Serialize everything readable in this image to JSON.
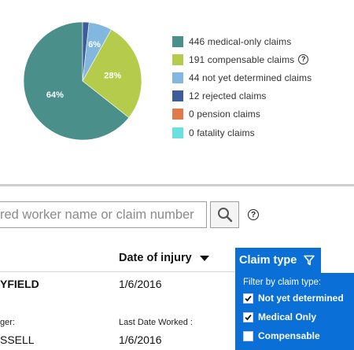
{
  "chart_data": {
    "type": "pie",
    "slices": [
      {
        "label": "446 medical-only claims",
        "value": 446,
        "color": "#4a8f8a",
        "pct_label": "64%"
      },
      {
        "label": "191 compensable claims",
        "value": 191,
        "color": "#b5cb4b",
        "pct_label": "28%"
      },
      {
        "label": "44 not yet determined claims",
        "value": 44,
        "color": "#82b8df",
        "pct_label": "6%"
      },
      {
        "label": "12 rejected claims",
        "value": 12,
        "color": "#3d5c9a",
        "pct_label": ""
      },
      {
        "label": "0 pension claims",
        "value": 0,
        "color": "#e07a4d",
        "pct_label": ""
      },
      {
        "label": "0 fatality claims",
        "value": 0,
        "color": "#6be0df",
        "pct_label": ""
      }
    ]
  },
  "legend": {
    "compensable_help_icon": "?"
  },
  "search": {
    "placeholder": "red worker name or claim number",
    "help": "?"
  },
  "table": {
    "date_header": "Date of injury",
    "row1_name": "YFIELD",
    "row1_date": "1/6/2016",
    "row2_label": "ger:",
    "row2_last_worked_label": "Last Date Worked :",
    "row3_name": "SSELL",
    "row3_date": "1/6/2016"
  },
  "filter": {
    "tab_label": "Claim type",
    "panel_label": "Filter by claim type:",
    "options": [
      {
        "label": "Not yet determined",
        "checked": true
      },
      {
        "label": "Medical Only",
        "checked": true
      },
      {
        "label": "Compensable",
        "checked": false
      }
    ]
  }
}
